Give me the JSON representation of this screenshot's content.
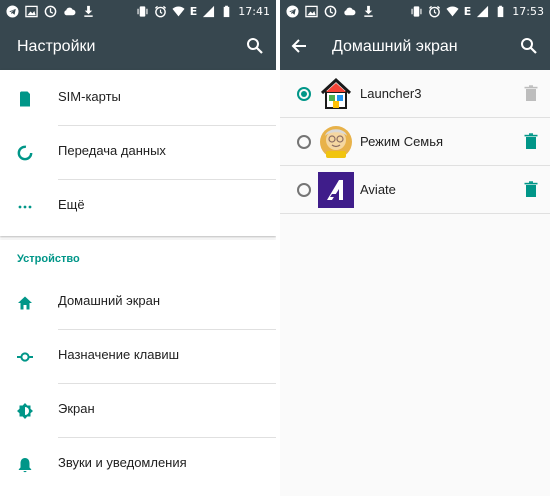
{
  "colors": {
    "appbar": "#37474f",
    "accent": "#009688",
    "text": "#212121",
    "trash_disabled": "#bdbdbd"
  },
  "left": {
    "status": {
      "time": "17:41",
      "network": "E"
    },
    "title": "Настройки",
    "items_top": [
      {
        "label": "SIM-карты",
        "icon": "sim-card-icon"
      },
      {
        "label": "Передача данных",
        "icon": "data-usage-icon"
      },
      {
        "label": "Ещё",
        "icon": "more-horiz-icon"
      }
    ],
    "section_title": "Устройство",
    "items_device": [
      {
        "label": "Домашний экран",
        "icon": "home-icon"
      },
      {
        "label": "Назначение клавиш",
        "icon": "button-mapping-icon"
      },
      {
        "label": "Экран",
        "icon": "brightness-icon"
      },
      {
        "label": "Звуки и уведомления",
        "icon": "bell-icon"
      }
    ]
  },
  "right": {
    "status": {
      "time": "17:53",
      "network": "E"
    },
    "title": "Домашний экран",
    "launchers": [
      {
        "label": "Launcher3",
        "selected": true,
        "icon": "launcher3-house-icon",
        "trash_enabled": false
      },
      {
        "label": "Режим Семья",
        "selected": false,
        "icon": "family-mode-icon",
        "trash_enabled": true
      },
      {
        "label": "Aviate",
        "selected": false,
        "icon": "aviate-icon",
        "trash_enabled": true
      }
    ]
  }
}
